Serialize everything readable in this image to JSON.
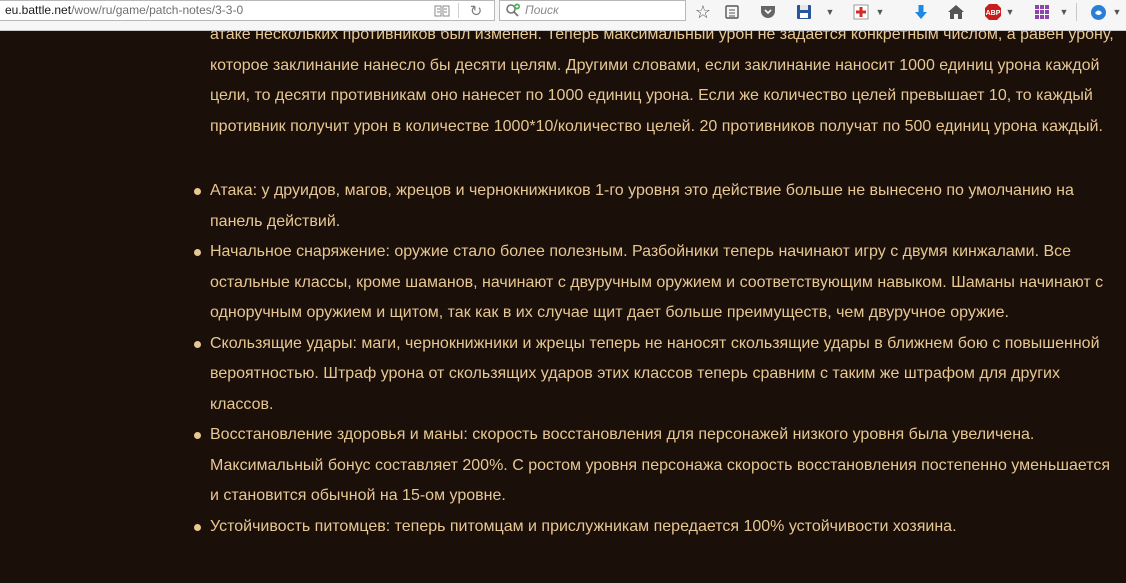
{
  "browser": {
    "url_host": "eu.battle.net",
    "url_path": "/wow/ru/game/patch-notes/3-3-0",
    "search_placeholder": "Поиск",
    "abp_label": "ABP"
  },
  "content": {
    "intro_text": "атаке нескольких противников был изменен. Теперь максимальный урон не задается конкретным числом, а равен урону, которое заклинание нанесло бы десяти целям. Другими словами, если заклинание наносит 1000 единиц урона каждой цели, то десяти противникам оно нанесет по 1000 единиц урона. Если же количество целей превышает 10, то каждый противник получит урон в количестве 1000*10/количество целей. 20 противников получат по 500 единиц урона каждый.",
    "items": [
      "Атака: у друидов, магов, жрецов и чернокнижников 1-го уровня это действие больше не вынесено по умолчанию на панель действий.",
      "Начальное снаряжение: оружие стало более полезным. Разбойники теперь начинают игру с двумя кинжалами. Все остальные классы, кроме шаманов, начинают с двуручным оружием и соответствующим навыком. Шаманы начинают с одноручным оружием и щитом, так как в их случае щит дает больше преимуществ, чем двуручное оружие.",
      "Скользящие удары: маги, чернокнижники и жрецы теперь не наносят скользящие удары в ближнем бою с повышенной вероятностью. Штраф урона от скользящих ударов этих классов теперь сравним с таким же штрафом для других классов.",
      "Восстановление здоровья и маны: скорость восстановления для персонажей низкого уровня была увеличена. Максимальный бонус составляет 200%. С ростом уровня персонажа скорость восстановления постепенно уменьшается и становится обычной на 15-ом уровне.",
      "Устойчивость питомцев: теперь питомцам и прислужникам передается 100% устойчивости хозяина."
    ]
  },
  "icons": [
    "bookmark-star-icon",
    "library-icon",
    "pocket-icon",
    "save-icon",
    "add-icon",
    "download-icon",
    "home-icon",
    "adblock-icon",
    "apps-grid-icon",
    "overflow-menu-icon",
    "extension-icon"
  ],
  "colors": {
    "page_bg": "#1b0f0a",
    "text": "#e7c792",
    "toolbar_bg": "#f6f6f6"
  }
}
